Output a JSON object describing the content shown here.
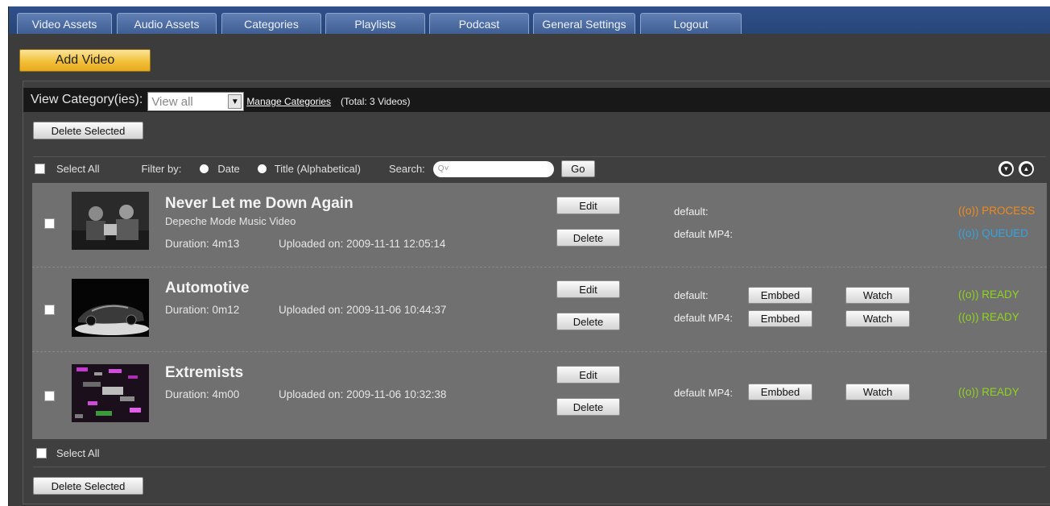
{
  "tabs": [
    "Video Assets",
    "Audio Assets",
    "Categories",
    "Playlists",
    "Podcast",
    "General Settings",
    "Logout"
  ],
  "add_video_label": "Add Video",
  "view": {
    "label": "View Category(ies):",
    "selected": "View all",
    "manage_link": "Manage Categories",
    "total": "(Total: 3 Videos)"
  },
  "delete_selected_label": "Delete Selected",
  "filter": {
    "select_all": "Select All",
    "filter_by": "Filter by:",
    "date": "Date",
    "title": "Title (Alphabetical)",
    "search": "Search:",
    "search_placeholder": "Q˅",
    "go": "Go"
  },
  "buttons": {
    "edit": "Edit",
    "delete": "Delete",
    "embed": "Embbed",
    "watch": "Watch"
  },
  "videos": [
    {
      "title": "Never Let me Down Again",
      "subtitle": "Depeche Mode Music Video",
      "duration": "Duration:  4m13",
      "uploaded": "Uploaded on:  2009-11-11 12:05:14",
      "formats": [
        {
          "name": "default:",
          "status_icon": "((o))",
          "status": "PROCESS"
        },
        {
          "name": "default MP4:",
          "status_icon": "((o))",
          "status": "QUEUED"
        }
      ]
    },
    {
      "title": "Automotive",
      "duration": "Duration:  0m12",
      "uploaded": "Uploaded on:  2009-11-06 10:44:37",
      "formats": [
        {
          "name": "default:",
          "status_icon": "((o))",
          "status": "READY"
        },
        {
          "name": "default MP4:",
          "status_icon": "((o))",
          "status": "READY"
        }
      ]
    },
    {
      "title": "Extremists",
      "duration": "Duration:  4m00",
      "uploaded": "Uploaded on:  2009-11-06 10:32:38",
      "formats": [
        {
          "name": "default MP4:",
          "status_icon": "((o))",
          "status": "READY"
        }
      ]
    }
  ],
  "colors": {
    "tabbar": "#2a4a80",
    "add_button": "#f2c13a",
    "processing": "#f08a1e",
    "queued": "#35a3e0",
    "ready": "#8fd41e"
  }
}
